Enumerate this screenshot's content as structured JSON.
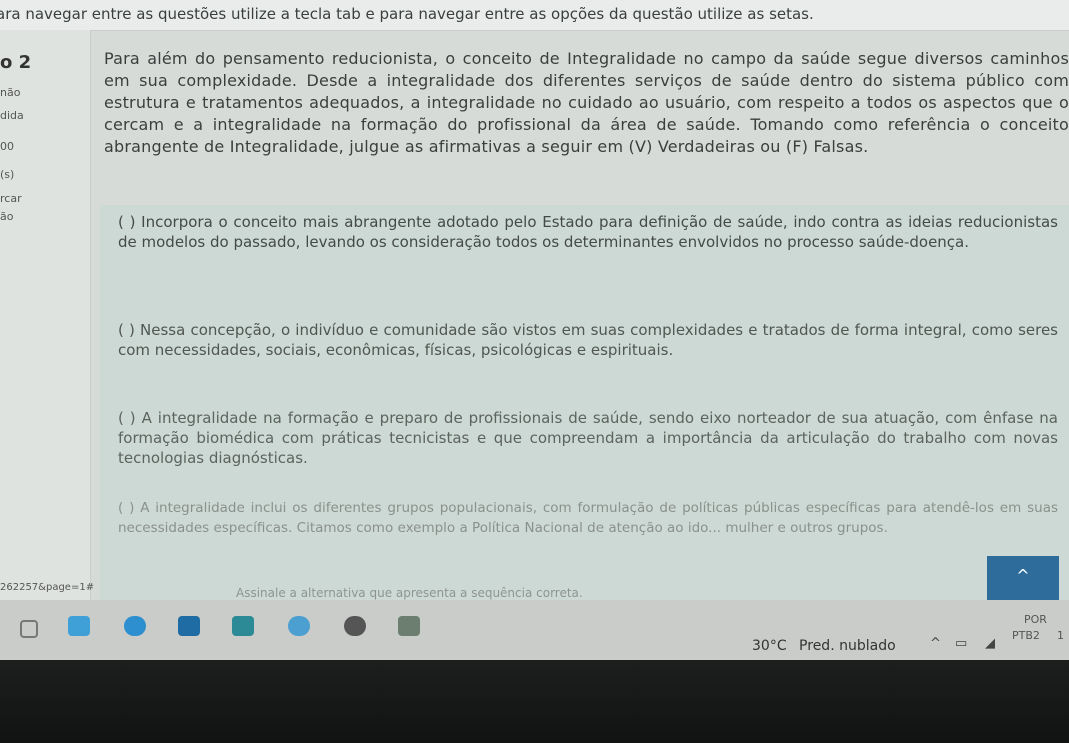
{
  "header": {
    "instructions": "ara navegar entre as questões utilize a tecla tab e para navegar entre as opções da questão utilize as setas."
  },
  "sidebar": {
    "question_number": "o 2",
    "fragments": [
      "não",
      "dida",
      "00",
      "(s)",
      "rcar",
      "ão"
    ],
    "url_fragment": "262257&page=1#"
  },
  "question": {
    "text": "Para além do pensamento reducionista, o conceito de Integralidade no campo da saúde segue diversos caminhos em sua complexidade. Desde a integralidade dos diferentes serviços de saúde dentro do sistema público com estrutura e tratamentos adequados, a integralidade no cuidado ao usuário, com respeito a todos os aspectos que o cercam e a integralidade na formação do profissional da área de saúde. Tomando como referência o conceito abrangente de Integralidade, julgue as afirmativas a seguir em (V) Verdadeiras ou (F) Falsas.",
    "items": [
      "( ) Incorpora o conceito mais abrangente adotado pelo Estado para definição de saúde, indo contra as ideias reducionistas de modelos do passado, levando os consideração todos os determinantes envolvidos no processo saúde-doença.",
      "( ) Nessa concepção, o indivíduo e comunidade são vistos em suas complexidades e tratados de forma integral, como seres com necessidades, sociais, econômicas, físicas, psicológicas e espirituais.",
      "( ) A integralidade na formação e preparo de profissionais de saúde, sendo eixo norteador de sua atuação, com ênfase na formação biomédica com práticas tecnicistas e que compreendam a importância da articulação do trabalho com novas tecnologias diagnósticas.",
      "( ) A integralidade inclui os diferentes grupos populacionais, com formulação de políticas públicas específicas para atendê-los em suas necessidades específicas. Citamos como exemplo a Política Nacional de atenção ao ido... mulher e outros grupos."
    ],
    "instruction": "Assinale a alternativa que apresenta a sequência correta."
  },
  "scroll_button": {
    "label": "^"
  },
  "taskbar": {
    "temperature": "30°C",
    "weather": "Pred. nublado",
    "tray_icons": [
      "chevron-up-icon",
      "battery-icon",
      "network-icon"
    ],
    "language": "POR",
    "layout": "PTB2",
    "partial_time": "1"
  },
  "colors": {
    "page_bg": "#d7dbd8",
    "panel_bg": "#cdd9d4",
    "accent": "#2e6d9b",
    "bezel": "#151616"
  }
}
